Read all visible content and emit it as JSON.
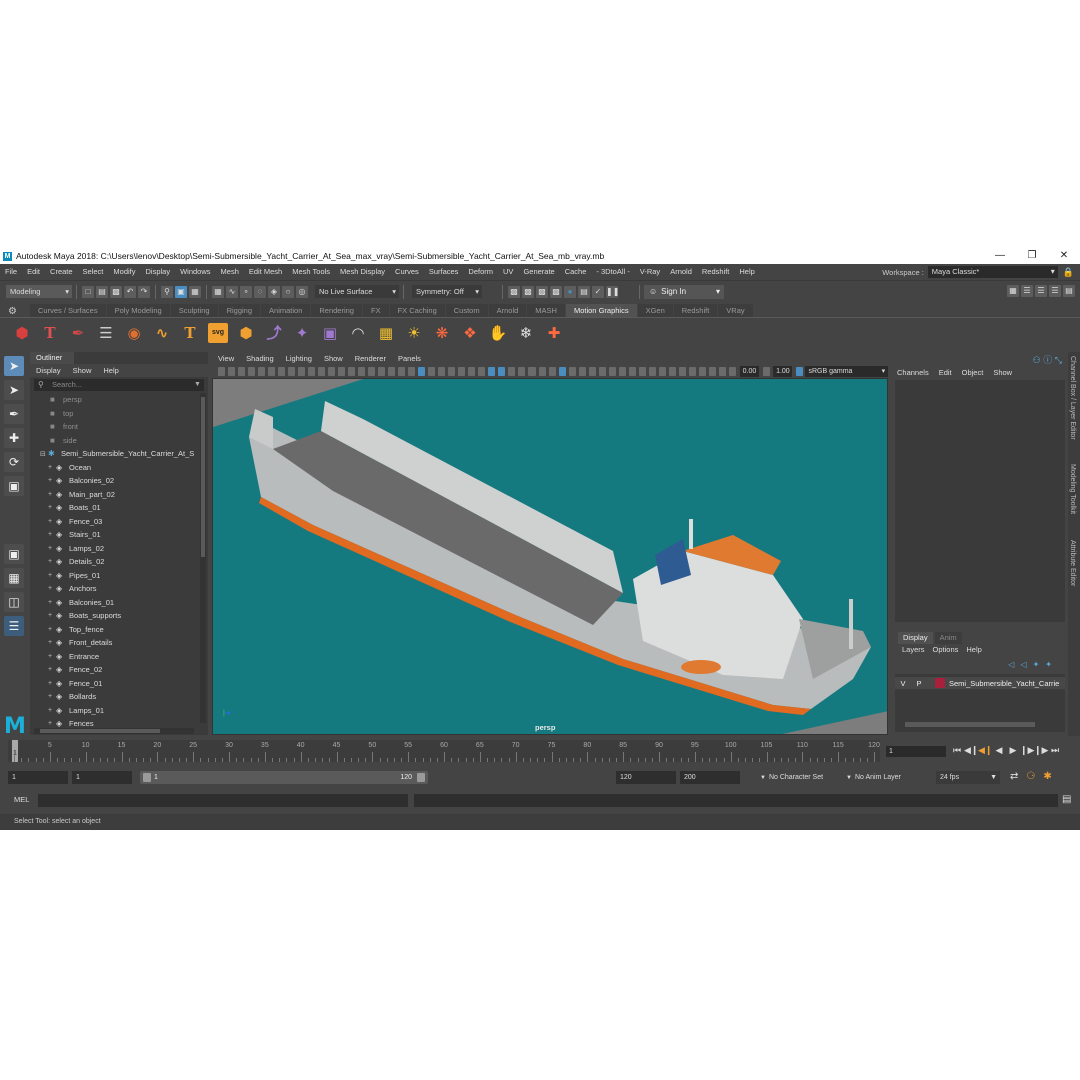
{
  "titlebar": {
    "title": "Autodesk Maya 2018: C:\\Users\\lenov\\Desktop\\Semi-Submersible_Yacht_Carrier_At_Sea_max_vray\\Semi-Submersible_Yacht_Carrier_At_Sea_mb_vray.mb",
    "logo": "M"
  },
  "menu": [
    "File",
    "Edit",
    "Create",
    "Select",
    "Modify",
    "Display",
    "Windows",
    "Mesh",
    "Edit Mesh",
    "Mesh Tools",
    "Mesh Display",
    "Curves",
    "Surfaces",
    "Deform",
    "UV",
    "Generate",
    "Cache",
    "- 3DtoAll -",
    "V-Ray",
    "Arnold",
    "Redshift",
    "Help"
  ],
  "workspace": {
    "label": "Workspace :",
    "value": "Maya Classic*"
  },
  "status": {
    "mode": "Modeling",
    "live_surface": "No Live Surface",
    "symmetry": "Symmetry: Off",
    "sign_in": "Sign In"
  },
  "shelf_tabs": [
    "Curves / Surfaces",
    "Poly Modeling",
    "Sculpting",
    "Rigging",
    "Animation",
    "Rendering",
    "FX",
    "FX Caching",
    "Custom",
    "Arnold",
    "MASH",
    "Motion Graphics",
    "XGen",
    "Redshift",
    "VRay"
  ],
  "active_shelf": "Motion Graphics",
  "outliner": {
    "title": "Outliner",
    "menu": [
      "Display",
      "Show",
      "Help"
    ],
    "search_placeholder": "Search...",
    "cameras": [
      "persp",
      "top",
      "front",
      "side"
    ],
    "root": "Semi_Submersible_Yacht_Carrier_At_S",
    "items": [
      "Ocean",
      "Balconies_02",
      "Main_part_02",
      "Boats_01",
      "Fence_03",
      "Stairs_01",
      "Lamps_02",
      "Details_02",
      "Pipes_01",
      "Anchors",
      "Balconies_01",
      "Boats_supports",
      "Top_fence",
      "Front_details",
      "Entrance",
      "Fence_02",
      "Fence_01",
      "Bollards",
      "Lamps_01",
      "Fences"
    ]
  },
  "viewport": {
    "menu": [
      "View",
      "Shading",
      "Lighting",
      "Show",
      "Renderer",
      "Panels"
    ],
    "exposure": "0.00",
    "gamma_value": "1.00",
    "color_space": "sRGB gamma",
    "camera_label": "persp"
  },
  "channel_box": {
    "menu": [
      "Channels",
      "Edit",
      "Object",
      "Show"
    ],
    "layer_tabs": [
      "Display",
      "Anim"
    ],
    "layer_menu": [
      "Layers",
      "Options",
      "Help"
    ],
    "layer": {
      "v": "V",
      "p": "P",
      "name": "Semi_Submersible_Yacht_Carrie",
      "color": "#a8203c"
    },
    "side_tabs": [
      "Channel Box / Layer Editor",
      "Modeling Toolkit",
      "Attribute Editor"
    ]
  },
  "timeline": {
    "ticks": [
      "1",
      "5",
      "10",
      "15",
      "20",
      "25",
      "30",
      "35",
      "40",
      "45",
      "50",
      "55",
      "60",
      "65",
      "70",
      "75",
      "80",
      "85",
      "90",
      "95",
      "100",
      "105",
      "110",
      "115",
      "120"
    ],
    "current_frame": "1",
    "frame_field": "1"
  },
  "range": {
    "start": "1",
    "playback_start": "1",
    "slider_start": "1",
    "slider_end": "120",
    "playback_end": "120",
    "end": "200",
    "character_set": "No Character Set",
    "anim_layer": "No Anim Layer",
    "fps": "24 fps"
  },
  "command": {
    "label": "MEL"
  },
  "help_line": "Select Tool: select an object",
  "colors": {
    "ui_bg": "#444444",
    "ocean": "#157a80",
    "accent": "#4a8dc0",
    "maya_blue": "#1ab0d8"
  }
}
